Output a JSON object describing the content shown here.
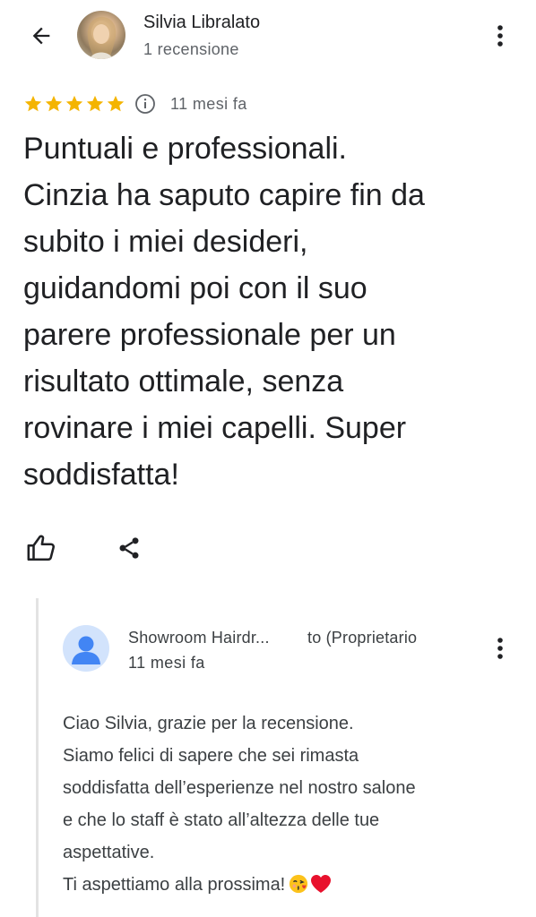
{
  "header": {
    "back_icon": "arrow-left-icon",
    "author_name": "Silvia Libralato",
    "author_reviews": "1 recensione",
    "more_icon": "more-vert-icon"
  },
  "review": {
    "rating": 5,
    "rating_max": 5,
    "star_color": "#f4b400",
    "time": "11 mesi fa",
    "lines": [
      "Puntuali e professionali.",
      "Cinzia ha saputo capire fin da",
      "subito i miei desideri,",
      "guidandomi poi con il suo",
      "parere professionale per un",
      "risultato ottimale, senza",
      "rovinare i miei capelli. Super",
      "soddisfatta!"
    ]
  },
  "actions": {
    "like_icon": "thumb-up-icon",
    "share_icon": "share-icon"
  },
  "owner_reply": {
    "name": "Showroom Hairdr...",
    "role": "to (Proprietario",
    "time": "11 mesi fa",
    "lines": [
      "Ciao Silvia, grazie per la recensione.",
      "Siamo felici di sapere che sei rimasta",
      "soddisfatta dell’esperienze nel nostro salone",
      "e che lo staff è stato all’altezza delle tue",
      "aspettative.",
      "Ti aspettiamo alla prossima!"
    ],
    "emojis": [
      "face-blowing-kiss-emoji",
      "red-heart-emoji"
    ],
    "avatar_color": "#d2e3fc",
    "avatar_icon_color": "#4285f4"
  }
}
